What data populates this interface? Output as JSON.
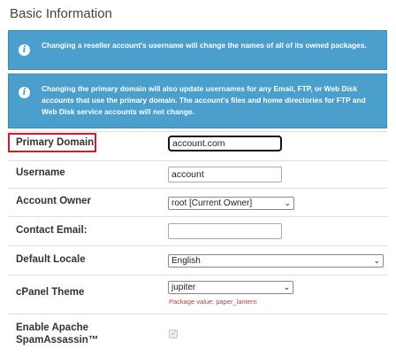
{
  "section": {
    "title": "Basic Information"
  },
  "alerts": [
    {
      "icon": "info-icon",
      "text": "Changing a reseller account's username will change the names of all of its owned packages."
    },
    {
      "icon": "info-icon",
      "text": "Changing the primary domain will also update usernames for any Email, FTP, or Web Disk accounts that use the primary domain. The account's files and home directories for FTP and Web Disk service accounts will not change."
    }
  ],
  "form": {
    "primary_domain": {
      "label": "Primary Domain",
      "value": "account.com"
    },
    "username": {
      "label": "Username",
      "value": "account"
    },
    "account_owner": {
      "label": "Account Owner",
      "selected": "root [Current Owner]"
    },
    "contact_email": {
      "label": "Contact Email:",
      "value": ""
    },
    "default_locale": {
      "label": "Default Locale",
      "selected": "English"
    },
    "cpanel_theme": {
      "label": "cPanel Theme",
      "selected": "jupiter",
      "hint": "Package value: paper_lantern"
    },
    "spamassassin": {
      "label_line1": "Enable Apache",
      "label_line2": "SpamAssassin™",
      "checked": true,
      "disabled": true
    }
  },
  "colors": {
    "alert_bg": "#4a9fcc",
    "highlight_border": "#d71a21",
    "hint_text": "#b0413e"
  }
}
